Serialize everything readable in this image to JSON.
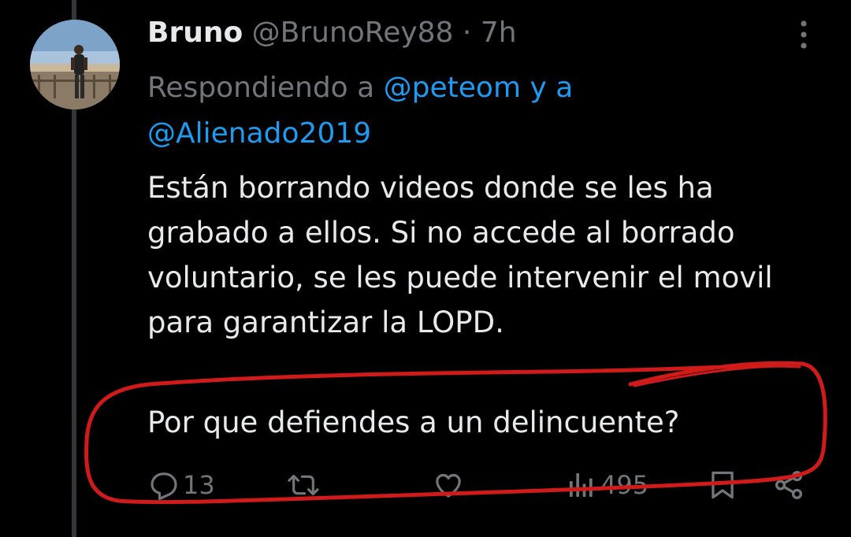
{
  "post": {
    "display_name": "Bruno",
    "handle": "@BrunoRey88",
    "separator": "·",
    "time": "7h",
    "replying_prefix": "Respondiendo a",
    "replying_user1": "@peteom",
    "replying_conjunction": "y a",
    "replying_user2": "@Alienado2019",
    "text_paragraph1": "Están borrando videos donde se les ha grabado a ellos. Si no accede al borrado voluntario, se les puede intervenir el movil para garantizar la LOPD.",
    "text_paragraph2": "Por que defiendes a un delincuente?"
  },
  "actions": {
    "replies_icon": "reply-icon",
    "replies_count": "13",
    "retweet_icon": "retweet-icon",
    "like_icon": "heart-icon",
    "views_icon": "views-icon",
    "views_count": "495",
    "bookmark_icon": "bookmark-icon",
    "share_icon": "share-icon"
  },
  "colors": {
    "background": "#000000",
    "text": "#e7e9ea",
    "muted": "#71767b",
    "link": "#1d9bf0",
    "annotation": "#d11a1a"
  }
}
